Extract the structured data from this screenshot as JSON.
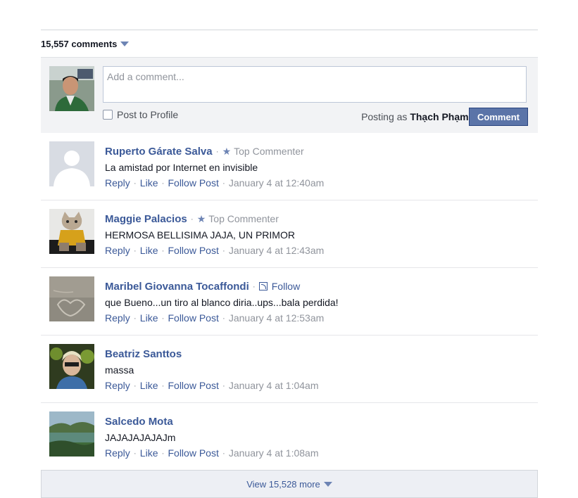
{
  "comments_count": "15,557 comments",
  "composer": {
    "placeholder": "Add a comment...",
    "post_to_profile": "Post to Profile",
    "posting_as_prefix": "Posting as",
    "posting_as_name": "Thạch Phạm",
    "comment_button": "Comment"
  },
  "separator": "·",
  "comments": [
    {
      "author": "Ruperto Gárate Salva",
      "badge": "Top Commenter",
      "badge_type": "star",
      "text": "La amistad por Internet en invisible",
      "reply": "Reply",
      "like": "Like",
      "follow_post": "Follow Post",
      "date": "January 4 at 12:40am",
      "avatar": "default-silhouette"
    },
    {
      "author": "Maggie Palacios",
      "badge": "Top Commenter",
      "badge_type": "star",
      "text": "HERMOSA BELLISIMA JAJA, UN PRIMOR",
      "reply": "Reply",
      "like": "Like",
      "follow_post": "Follow Post",
      "date": "January 4 at 12:43am",
      "avatar": "cat-photo"
    },
    {
      "author": "Maribel Giovanna Tocaffondi",
      "badge": "Follow",
      "badge_type": "follow",
      "text": "que Bueno...un tiro al blanco diria..ups...bala perdida!",
      "reply": "Reply",
      "like": "Like",
      "follow_post": "Follow Post",
      "date": "January 4 at 12:53am",
      "avatar": "sand-heart-photo"
    },
    {
      "author": "Beatriz Santtos",
      "badge": "",
      "badge_type": "none",
      "text": "massa",
      "reply": "Reply",
      "like": "Like",
      "follow_post": "Follow Post",
      "date": "January 4 at 1:04am",
      "avatar": "person-photo"
    },
    {
      "author": "Salcedo Mota",
      "badge": "",
      "badge_type": "none",
      "text": "JAJAJAJAJAJm",
      "reply": "Reply",
      "like": "Like",
      "follow_post": "Follow Post",
      "date": "January 4 at 1:08am",
      "avatar": "landscape-photo"
    }
  ],
  "view_more": "View 15,528 more"
}
